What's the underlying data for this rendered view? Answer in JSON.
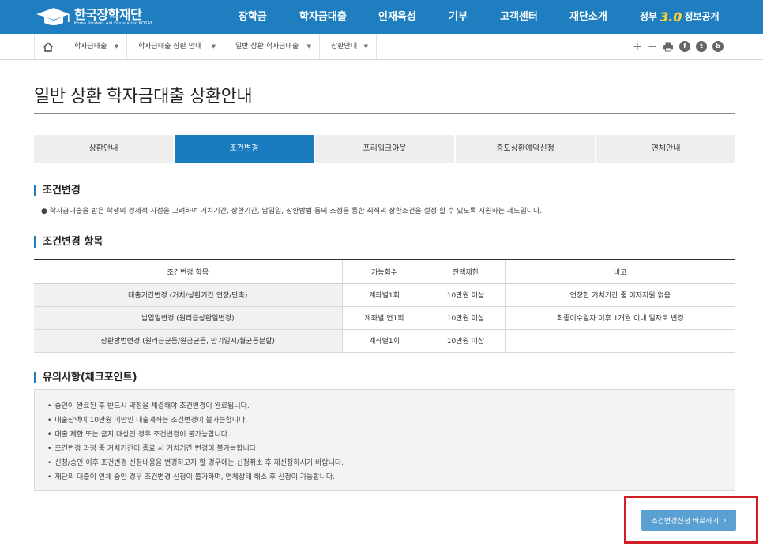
{
  "header": {
    "logo_ko": "한국장학재단",
    "logo_en": "Korea Student Aid Foundation KOSAF",
    "nav": [
      "장학금",
      "학자금대출",
      "인재육성",
      "기부",
      "고객센터",
      "재단소개"
    ],
    "gov_prefix": "정부",
    "gov_number": "3.0",
    "gov_suffix": "정보공개",
    "bg_color": "#1e7ec0"
  },
  "location": {
    "home_icon": "home-icon",
    "items": [
      "학자금대출",
      "학자금대출 상환 안내",
      "일반 상환 학자금대출",
      "상환안내"
    ],
    "tools": {
      "plus": "+",
      "minus": "−",
      "print": "print-icon",
      "facebook": "f",
      "twitter": "t",
      "blog": "b"
    }
  },
  "page_title": "일반 상환 학자금대출 상환안내",
  "tabs": [
    "상환안내",
    "조건변경",
    "프리워크아웃",
    "중도상환예약신청",
    "연체안내"
  ],
  "active_tab": "조건변경",
  "section1": {
    "heading": "조건변경",
    "description": "학자금대출을 받은 학생의 경제적 사정을 고려하여 거치기간, 상환기간, 납입일, 상환방법 등의 조정을 통한 최적의 상환조건을 설정 할 수 있도록 지원하는 제도입니다."
  },
  "section2": {
    "heading": "조건변경 항목",
    "columns": [
      "조건변경 항목",
      "가능회수",
      "잔액제한",
      "비고"
    ],
    "rows": [
      [
        "대출기간변경 (거치/상환기간 연장/단축)",
        "계좌별1회",
        "10만원 이상",
        "연장한 거치기간 중 이자지원 없음"
      ],
      [
        "납입일변경 (원리금상환일변경)",
        "계좌별 연1회",
        "10만원 이상",
        "최종이수일자 이후 1개월 이내 일자로 변경"
      ],
      [
        "상환방법변경 (원리금균등/원금균등, 만기일시/월균등분할)",
        "계좌별1회",
        "10만원 이상",
        ""
      ]
    ]
  },
  "section3": {
    "heading": "유의사항(체크포인트)",
    "notes": [
      "승인이 완료된 후 반드시 약정을 체결해야 조건변경이 완료됩니다.",
      "대출잔액이 10만원 미만인 대출계좌는 조건변경이 불가능합니다.",
      "대출 제한 또는 금지 대상인 경우 조건변경이 불가능합니다.",
      "조건변경 과정 중 거치기간이 종료 시 거치기간 변경이 불가능합니다.",
      "신청/승인 이후 조건변경 신청내용을 변경하고자 할 경우에는 신청취소 후 재신청하시기 바랍니다.",
      "재단의 대출이 연체 중인 경우 조건변경 신청이 불가하며, 연체상태 해소 후 신청이 가능합니다."
    ]
  },
  "cta": {
    "label": "조건변경신청 바로하기",
    "arrow": "›"
  },
  "colors": {
    "accent": "#1b7bbf",
    "cta": "#5aa0d3",
    "highlight": "#d21f27"
  }
}
